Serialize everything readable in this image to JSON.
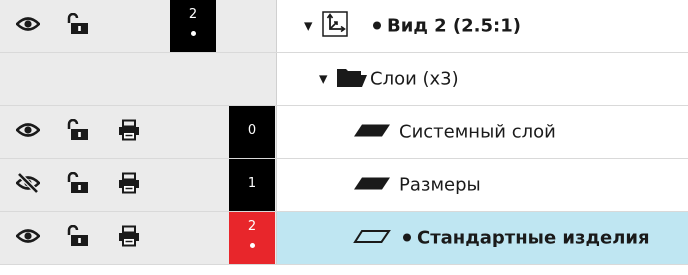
{
  "rows": [
    {
      "name": "Вид 2 (2.5:1)",
      "number": "2"
    },
    {
      "name": "Слои (x3)"
    },
    {
      "name": "Системный слой",
      "number": "0"
    },
    {
      "name": "Размеры",
      "number": "1"
    },
    {
      "name": "Стандартные изделия",
      "number": "2"
    }
  ],
  "icons": {
    "visible": "eye-icon",
    "hidden": "eye-slash-icon",
    "lock": "lock-open-icon",
    "print": "printer-icon",
    "view": "view-axes-icon",
    "folder": "folder-icon",
    "layer": "layer-icon",
    "layer_outline": "layer-outline-icon",
    "expand": "expand-arrow-icon"
  },
  "colors": {
    "panel_bg": "#ebebeb",
    "badge_black": "#000000",
    "badge_red": "#e8262b",
    "selected_bg": "#bfe6f2",
    "text": "#1a1a1a"
  }
}
